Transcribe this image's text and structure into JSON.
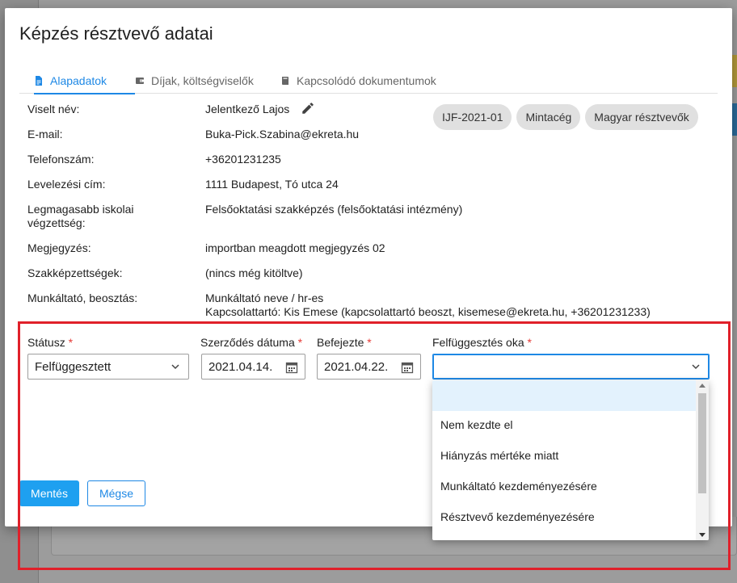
{
  "modal": {
    "title": "Képzés résztvevő adatai"
  },
  "tabs": [
    {
      "label": "Alapadatok",
      "icon": "document-icon",
      "active": true
    },
    {
      "label": "Díjak, költségviselők",
      "icon": "wallet-icon",
      "active": false
    },
    {
      "label": "Kapcsolódó dokumentumok",
      "icon": "book-icon",
      "active": false
    }
  ],
  "fields": {
    "name_label": "Viselt név:",
    "name_value": "Jelentkező Lajos",
    "email_label": "E-mail:",
    "email_value": "Buka-Pick.Szabina@ekreta.hu",
    "phone_label": "Telefonszám:",
    "phone_value": "+36201231235",
    "address_label": "Levelezési cím:",
    "address_value": "1111 Budapest, Tó utca 24",
    "education_label_1": "Legmagasabb iskolai",
    "education_label_2": "végzettség:",
    "education_value": "Felsőoktatási szakképzés (felsőoktatási intézmény)",
    "note_label": "Megjegyzés:",
    "note_value": "importban meagdott megjegyzés 02",
    "qualifications_label": "Szakképzettségek:",
    "qualifications_value": "(nincs még kitöltve)",
    "employer_label": "Munkáltató, beosztás:",
    "employer_value_1": "Munkáltató neve / hr-es",
    "employer_value_2": "Kapcsolattartó: Kis Emese (kapcsolattartó beoszt, kisemese@ekreta.hu, +36201231233)"
  },
  "chips": [
    "IJF-2021-01",
    "Mintacég",
    "Magyar résztvevők"
  ],
  "form": {
    "status_label": "Státusz",
    "status_value": "Felfüggesztett",
    "contract_date_label": "Szerződés dátuma",
    "contract_date_value": "2021.04.14.",
    "finished_label": "Befejezte",
    "finished_value": "2021.04.22.",
    "suspension_reason_label": "Felfüggesztés oka",
    "suspension_reason_value": "",
    "required_marker": "*"
  },
  "dropdown": {
    "options": [
      "",
      "Nem kezdte el",
      "Hiányzás mértéke miatt",
      "Munkáltató kezdeményezésére",
      "Résztvevő kezdeményezésére"
    ]
  },
  "buttons": {
    "save": "Mentés",
    "cancel": "Mégse"
  },
  "colors": {
    "accent": "#1e88e5",
    "save_button": "#1ea0f0",
    "required": "#e53935",
    "annotation_frame": "#e0202a"
  }
}
